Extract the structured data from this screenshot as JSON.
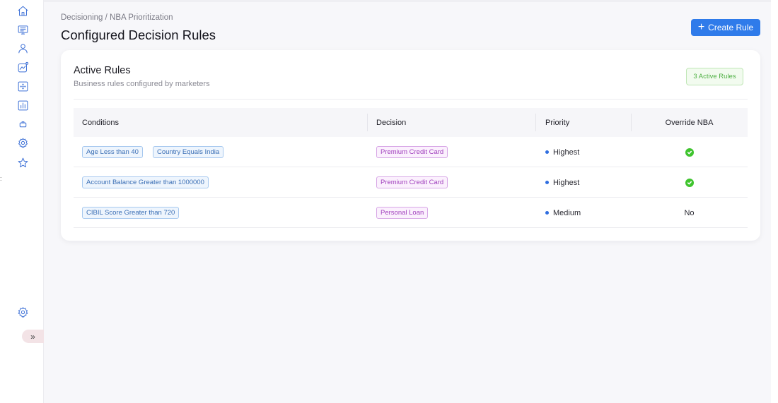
{
  "sidebar": {
    "icons": [
      "home-icon",
      "monitor-list-icon",
      "user-icon",
      "analytics-icon",
      "grid-scan-icon",
      "bar-chart-icon",
      "briefcase-icon",
      "settings-cog-alt-icon",
      "star-icon"
    ],
    "bottom_icon": "gear-icon",
    "side_dots": ":",
    "expand_label": "»"
  },
  "header": {
    "breadcrumb": "Decisioning / NBA Prioritization",
    "title": "Configured Decision Rules",
    "create_button": "Create Rule"
  },
  "card": {
    "title": "Active Rules",
    "subtitle": "Business rules configured by marketers",
    "badge": "3 Active Rules"
  },
  "table": {
    "columns": [
      "Conditions",
      "Decision",
      "Priority",
      "Override NBA"
    ],
    "rows": [
      {
        "conditions": [
          "Age Less than 40",
          "Country Equals India"
        ],
        "decision": "Premium Credit Card",
        "priority": "Highest",
        "override": true,
        "override_label": ""
      },
      {
        "conditions": [
          "Account Balance Greater than 1000000"
        ],
        "decision": "Premium Credit Card",
        "priority": "Highest",
        "override": true,
        "override_label": ""
      },
      {
        "conditions": [
          "CIBIL Score Greater than 720"
        ],
        "decision": "Personal Loan",
        "priority": "Medium",
        "override": false,
        "override_label": "No"
      }
    ]
  },
  "colors": {
    "accent": "#2f7bea",
    "success": "#3fc42e",
    "condition_tag": "#3b6fb5",
    "decision_tag": "#a040bd"
  }
}
